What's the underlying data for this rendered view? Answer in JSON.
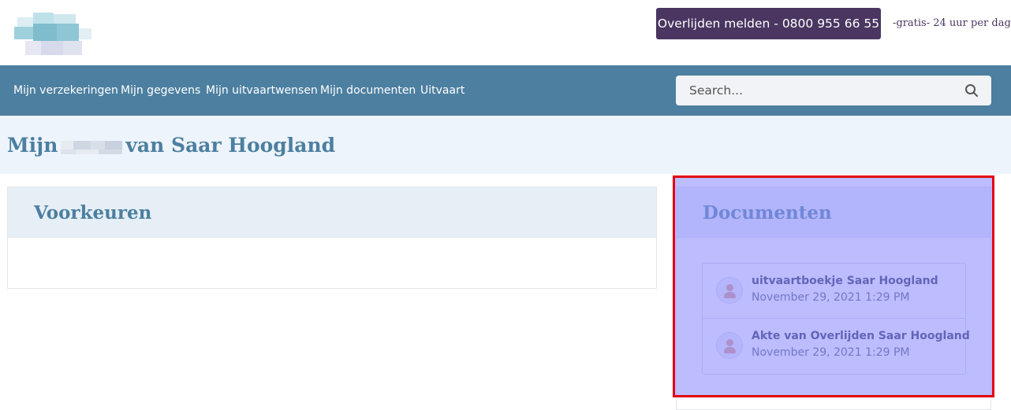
{
  "header": {
    "cta_label": "Overlijden melden - 0800 955 66 55",
    "cta_note": "-gratis- 24 uur per dag"
  },
  "nav": {
    "items": [
      {
        "label": "Mijn verzekeringen"
      },
      {
        "label": "Mijn gegevens"
      },
      {
        "label": "Mijn uitvaartwensen"
      },
      {
        "label": "Mijn documenten"
      },
      {
        "label": "Uitvaart"
      }
    ],
    "search_placeholder": "Search..."
  },
  "page": {
    "title_prefix": "Mijn",
    "title_suffix": "van Saar Hoogland"
  },
  "preferences": {
    "title": "Voorkeuren"
  },
  "documents": {
    "title": "Documenten",
    "items": [
      {
        "name": "uitvaartboekje Saar Hoogland",
        "date": "November 29, 2021 1:29 PM"
      },
      {
        "name": "Akte van Overlijden Saar Hoogland",
        "date": "November 29, 2021 1:29 PM"
      }
    ]
  },
  "colors": {
    "brand_dark": "#4a3661",
    "nav_blue": "#4c7fa0",
    "highlight": "#e3000f"
  }
}
